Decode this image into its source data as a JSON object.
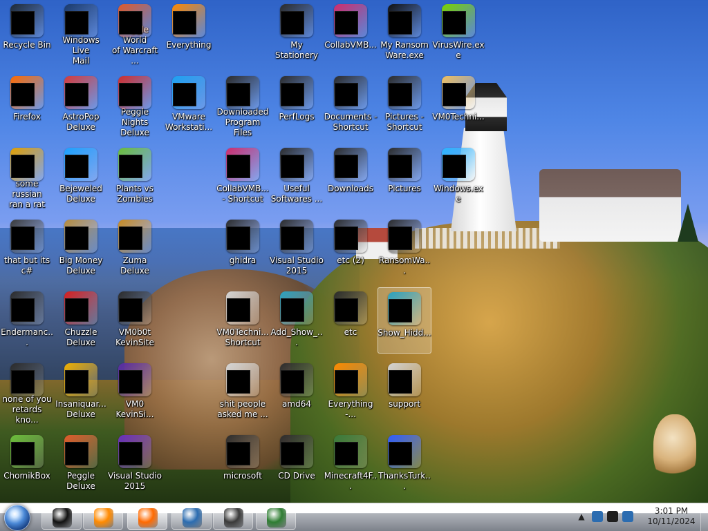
{
  "desktop": {
    "icons": [
      {
        "label": "Recycle Bin",
        "color": "#1f2a36"
      },
      {
        "label": "Windows Live\nMail",
        "color": "#1b3a6b"
      },
      {
        "label": "Peggle World\nof Warcraft ...",
        "color": "#e05a2a"
      },
      {
        "label": "Everything",
        "color": "#ff8a00"
      },
      {
        "label": "My Stationery",
        "color": "#2b2b2b"
      },
      {
        "label": "CollabVMB...",
        "color": "#cf2d6d"
      },
      {
        "label": "My Ransom\nWare.exe",
        "color": "#111111"
      },
      {
        "label": "VirusWire.exe",
        "color": "#7ad300"
      },
      {
        "label": "Firefox",
        "color": "#ff6a00"
      },
      {
        "label": "AstroPop\nDeluxe",
        "color": "#d63b3b"
      },
      {
        "label": "Peggle Nights\nDeluxe",
        "color": "#d02d2d"
      },
      {
        "label": "VMware\nWorkstati...",
        "color": "#1da1f2"
      },
      {
        "label": "Downloaded\nProgram Files",
        "color": "#2b2b2b"
      },
      {
        "label": "PerfLogs",
        "color": "#2b2b2b"
      },
      {
        "label": "Documents -\nShortcut",
        "color": "#2b2b2b"
      },
      {
        "label": "Pictures -\nShortcut",
        "color": "#2b2b2b"
      },
      {
        "label": "VM0Techni...",
        "color": "#f0c060"
      },
      {
        "label": "some russian\nran a rat",
        "color": "#e2a000"
      },
      {
        "label": "Bejeweled\nDeluxe",
        "color": "#1ca1ff"
      },
      {
        "label": "Plants vs\nZombies",
        "color": "#6bbd3a"
      },
      {
        "label": "CollabVMB...\n- Shortcut",
        "color": "#cf2d6d"
      },
      {
        "label": "Useful\nSoftwares ...",
        "color": "#2b2b2b"
      },
      {
        "label": "Downloads",
        "color": "#2b2b2b"
      },
      {
        "label": "Pictures",
        "color": "#2b2b2b"
      },
      {
        "label": "Windows.exe",
        "color": "#2bb3ff"
      },
      {
        "label": "that but its c#",
        "color": "#3b3b3b"
      },
      {
        "label": "Big Money\nDeluxe",
        "color": "#b58b3c"
      },
      {
        "label": "Zuma Deluxe",
        "color": "#c78a22"
      },
      {
        "label": "ghidra",
        "color": "#2b2b2b"
      },
      {
        "label": "Visual Studio\n2015",
        "color": "#2b2b2b"
      },
      {
        "label": "etc (2)",
        "color": "#2b2b2b"
      },
      {
        "label": "RansomWa...",
        "color": "#2a2a2a"
      },
      {
        "label": "Endermanc...",
        "color": "#2b2b2b"
      },
      {
        "label": "Chuzzle\nDeluxe",
        "color": "#d61f1f"
      },
      {
        "label": "VM0b0t\nKevinSite",
        "color": "#2b2b2b"
      },
      {
        "label": "VM0Techni...\nShortcut",
        "color": "#d4d4d4"
      },
      {
        "label": "Add_Show_...",
        "color": "#2aa2c0"
      },
      {
        "label": "etc",
        "color": "#2b2b2b"
      },
      {
        "label": "Show_Hidd...",
        "color": "#2aa2c0"
      },
      {
        "label": "none of you\nretards kno...",
        "color": "#2b2b2b"
      },
      {
        "label": "Insaniquar...\nDeluxe",
        "color": "#f0b000"
      },
      {
        "label": "VM0\nKevinSi...",
        "color": "#5a2aa2"
      },
      {
        "label": "shit people\nasked me ...",
        "color": "#d4d4d4"
      },
      {
        "label": "amd64",
        "color": "#2b2b2b"
      },
      {
        "label": "Everything -...",
        "color": "#ff8a00"
      },
      {
        "label": "support",
        "color": "#d4d4d4"
      },
      {
        "label": "ChomikBox",
        "color": "#6bbd3a"
      },
      {
        "label": "Peggle Deluxe",
        "color": "#e05a2a"
      },
      {
        "label": "Visual Studio\n2015",
        "color": "#6b2dbf"
      },
      {
        "label": "microsoft",
        "color": "#2b2b2b"
      },
      {
        "label": "CD Drive",
        "color": "#2b2b2b"
      },
      {
        "label": "Minecraft4F...",
        "color": "#3a7a3a"
      },
      {
        "label": "ThanksTurk...",
        "color": "#2e5cff"
      }
    ]
  },
  "taskbar": {
    "start_button": {
      "name": "Start"
    },
    "pinned": [
      {
        "label": "File Explorer",
        "color": "#111111"
      },
      {
        "label": "Media Player",
        "color": "#ff8a00"
      },
      {
        "label": "Firefox",
        "color": "#ff6a00"
      },
      {
        "label": "Network",
        "color": "#2b6cb0"
      },
      {
        "label": "RansomWare",
        "color": "#3a3a3a"
      },
      {
        "label": "Window",
        "color": "#2e7d32"
      }
    ],
    "tray": {
      "time": "3:01 PM",
      "date": "10/11/2024"
    }
  }
}
